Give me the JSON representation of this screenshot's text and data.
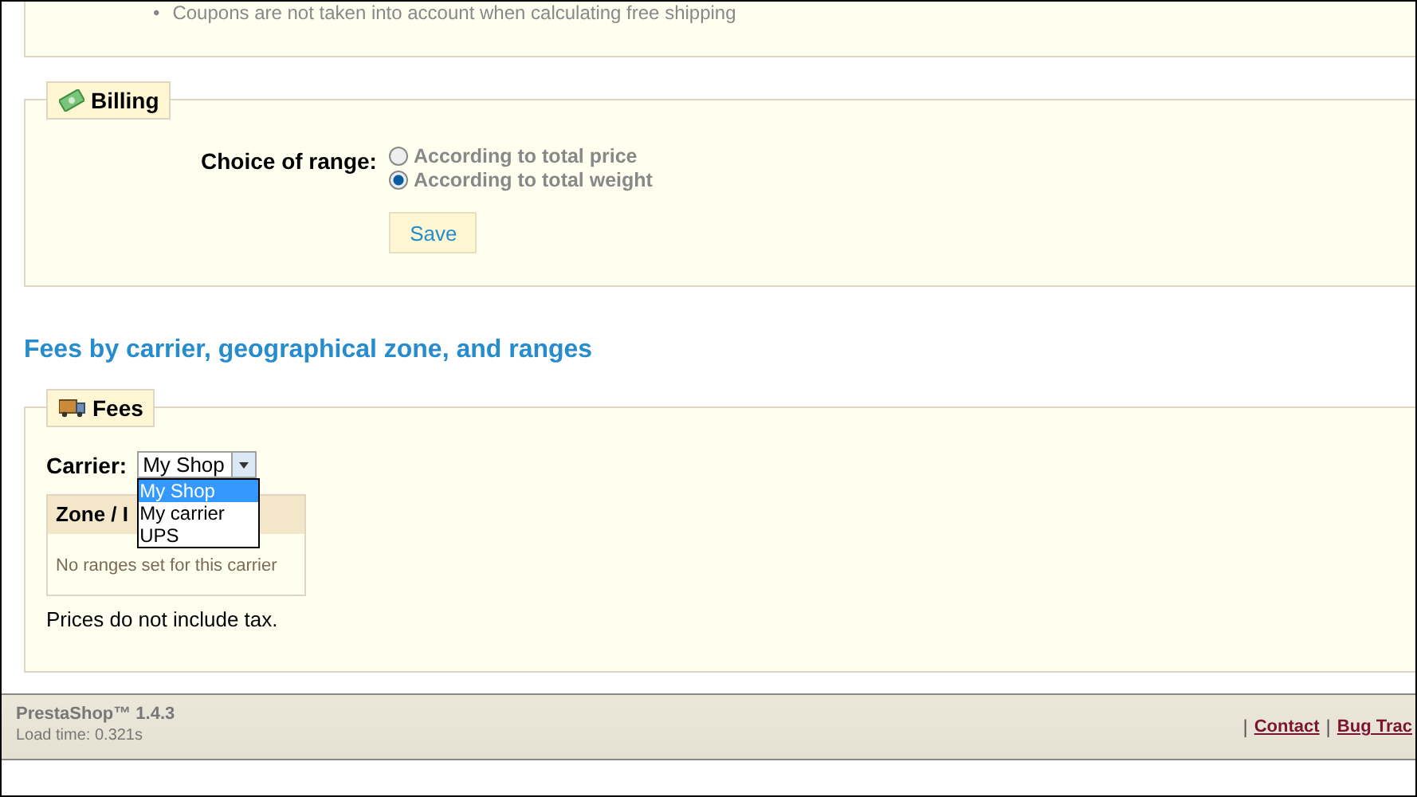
{
  "top_note": {
    "marker": "•",
    "bullet": "Coupons are not taken into account when calculating free shipping"
  },
  "billing": {
    "legend": "Billing",
    "label": "Choice of range:",
    "options": [
      {
        "label": "According to total price",
        "selected": false
      },
      {
        "label": "According to total weight",
        "selected": true
      }
    ],
    "save": "Save"
  },
  "heading": "Fees by carrier, geographical zone, and ranges",
  "fees": {
    "legend": "Fees",
    "carrier_label": "Carrier:",
    "carrier_value": "My Shop",
    "dropdown": [
      {
        "label": "My Shop",
        "selected": true
      },
      {
        "label": "My carrier",
        "selected": false
      },
      {
        "label": "UPS",
        "selected": false
      }
    ],
    "table_header": "Zone / I",
    "empty": "No ranges set for this carrier",
    "note": "Prices do not include tax."
  },
  "footer": {
    "version": "PrestaShop™ 1.4.3",
    "load_time": "Load time: 0.321s",
    "links": [
      {
        "separator": "|",
        "label": "Contact"
      },
      {
        "separator": "|",
        "label": "Bug Trac"
      }
    ]
  }
}
